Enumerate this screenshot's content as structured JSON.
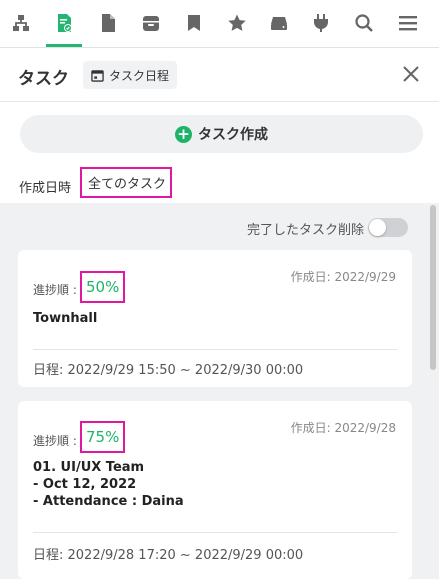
{
  "toolbar": {
    "icons": [
      "org-chart-icon",
      "task-icon",
      "document-icon",
      "archive-icon",
      "bookmark-icon",
      "star-icon",
      "storage-icon",
      "plugin-icon",
      "search-icon",
      "menu-icon"
    ],
    "active": "task-icon",
    "accent": "#22b573"
  },
  "header": {
    "title": "タスク",
    "schedule_chip": "タスク日程"
  },
  "create_button": "タスク作成",
  "filter": {
    "label": "作成日時",
    "value": "全てのタスク"
  },
  "delete_completed": {
    "label": "完了したタスク削除",
    "enabled": false
  },
  "tasks": [
    {
      "created": "作成日: 2022/9/29",
      "progress_label": "進捗順 :",
      "progress": "50%",
      "title": "Townhall",
      "schedule": "日程: 2022/9/29 15:50 ~ 2022/9/30 00:00"
    },
    {
      "created": "作成日: 2022/9/28",
      "progress_label": "進捗順 :",
      "progress": "75%",
      "title": "01. UI/UX Team\n- Oct 12, 2022\n- Attendance : Daina",
      "schedule": "日程: 2022/9/28 17:20 ~ 2022/9/29 00:00"
    }
  ],
  "colors": {
    "highlight": "#e0179f",
    "progress": "#1fb36a"
  }
}
